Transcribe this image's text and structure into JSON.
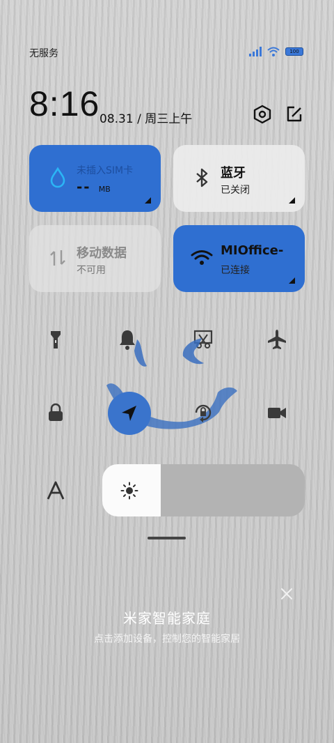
{
  "status_bar": {
    "carrier": "无服务",
    "battery": "100"
  },
  "header": {
    "time": "8:16",
    "date": "08.31 / 周三上午",
    "settings_icon": "gear-hexagon-icon",
    "edit_icon": "edit-icon"
  },
  "tiles": {
    "sim": {
      "title": "未插入SIM卡",
      "value": "--",
      "unit": "MB",
      "icon": "water-drop-icon"
    },
    "bluetooth": {
      "title": "蓝牙",
      "sub": "已关闭",
      "icon": "bluetooth-icon"
    },
    "mobile_data": {
      "title": "移动数据",
      "sub": "不可用",
      "icon": "data-arrows-icon"
    },
    "wifi": {
      "title": "MIOffice-",
      "sub": "已连接",
      "icon": "wifi-icon"
    }
  },
  "toggles": [
    {
      "name": "flashlight",
      "icon": "flashlight-icon"
    },
    {
      "name": "mute",
      "icon": "bell-icon"
    },
    {
      "name": "screenshot",
      "icon": "screenshot-scissors-icon"
    },
    {
      "name": "airplane",
      "icon": "airplane-icon"
    },
    {
      "name": "lock-screen",
      "icon": "lock-icon"
    },
    {
      "name": "location",
      "icon": "location-arrow-icon",
      "active": true
    },
    {
      "name": "auto-rotate",
      "icon": "rotate-lock-icon"
    },
    {
      "name": "screen-record",
      "icon": "video-camera-icon"
    }
  ],
  "brightness": {
    "level": 0.29,
    "icon": "sun-icon",
    "auto_icon": "font-a-icon"
  },
  "smart_home": {
    "title": "米家智能家庭",
    "subtitle": "点击添加设备，控制您的智能家居"
  },
  "colors": {
    "accent": "#2f6fd1",
    "tile_light": "#ebebeb"
  }
}
